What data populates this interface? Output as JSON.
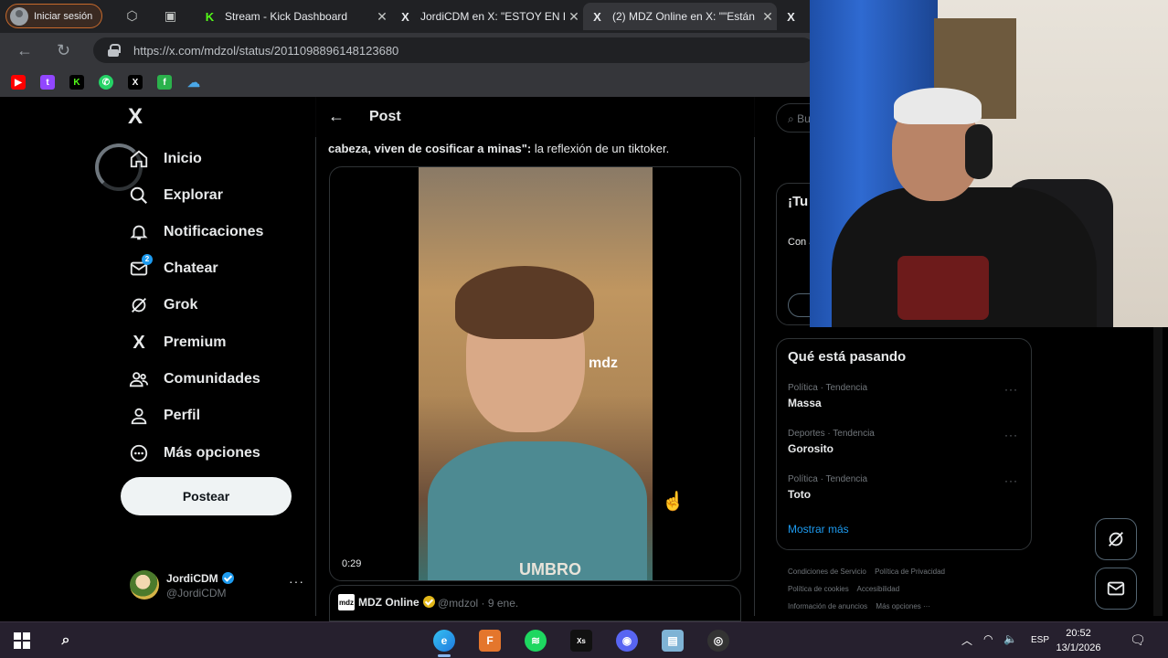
{
  "browser": {
    "signin_label": "Iniciar sesión",
    "tabs": [
      {
        "title": "Stream - Kick Dashboard",
        "favicon": "K"
      },
      {
        "title": "JordiCDM en X: \"ESTOY EN L",
        "favicon": "X"
      },
      {
        "title": "(2) MDZ Online en X: \"\"Están",
        "favicon": "X"
      },
      {
        "title": "",
        "favicon": "X"
      }
    ],
    "url": "https://x.com/mdzol/status/2011098896148123680",
    "url_host": "x.com",
    "bookmarks": [
      "youtube-icon",
      "twitch-icon",
      "kick-icon",
      "whatsapp-icon",
      "x-icon",
      "feedly-icon",
      "cloud-icon"
    ]
  },
  "x": {
    "logo": "X",
    "nav": [
      {
        "label": "Inicio",
        "icon": "home-icon"
      },
      {
        "label": "Explorar",
        "icon": "search-icon"
      },
      {
        "label": "Notificaciones",
        "icon": "bell-icon"
      },
      {
        "label": "Chatear",
        "icon": "chat-icon",
        "badge": "2"
      },
      {
        "label": "Grok",
        "icon": "grok-icon"
      },
      {
        "label": "Premium",
        "icon": "x-premium-icon"
      },
      {
        "label": "Comunidades",
        "icon": "communities-icon"
      },
      {
        "label": "Perfil",
        "icon": "profile-icon"
      },
      {
        "label": "Más opciones",
        "icon": "more-circle-icon"
      }
    ],
    "post_button": "Postear",
    "account": {
      "name": "JordiCDM",
      "handle": "@JordiCDM"
    },
    "header_title": "Post",
    "tweet": {
      "bold": "cabeza, viven de cosificar a minas\":",
      "rest": " la reflexión de un tiktoker.",
      "video_time": "0:29",
      "video_logo": "mdz",
      "video_brand": "UMBRO"
    },
    "quote": {
      "logo": "mdz",
      "name": "MDZ Online",
      "handle": "@mdzol · 9 ene."
    },
    "right": {
      "search_placeholder": "Bu",
      "promo_title": "¡Tu cac",
      "promo_desc": "Con azul, límit",
      "trends_title": "Qué está pasando",
      "trends": [
        {
          "category": "Política · Tendencia",
          "name": "Massa"
        },
        {
          "category": "Deportes · Tendencia",
          "name": "Gorosito"
        },
        {
          "category": "Política · Tendencia",
          "name": "Toto"
        }
      ],
      "show_more": "Mostrar más",
      "footer": [
        "Condiciones de Servicio",
        "Política de Privacidad",
        "Política de cookies",
        "Accesibilidad",
        "Información de anuncios",
        "Más opciones ···"
      ]
    }
  },
  "taskbar": {
    "lang": "ESP",
    "time": "20:52",
    "date": "13/1/2026"
  }
}
